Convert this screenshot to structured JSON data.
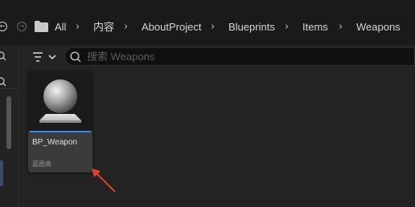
{
  "breadcrumb": {
    "items": [
      "All",
      "内容",
      "AboutProject",
      "Blueprints",
      "Items",
      "Weapons"
    ]
  },
  "icons": {
    "back": "back-arrow-icon",
    "forward": "forward-arrow-icon",
    "folder": "folder-icon",
    "filter": "filter-icon",
    "search": "search-icon",
    "sphere": "sphere-icon"
  },
  "search": {
    "placeholder": "搜索 Weapons"
  },
  "asset": {
    "name": "BP_Weapon",
    "type": "蓝图类"
  },
  "colors": {
    "accent": "#2f8ef0",
    "annotation_arrow": "#e0402a"
  }
}
